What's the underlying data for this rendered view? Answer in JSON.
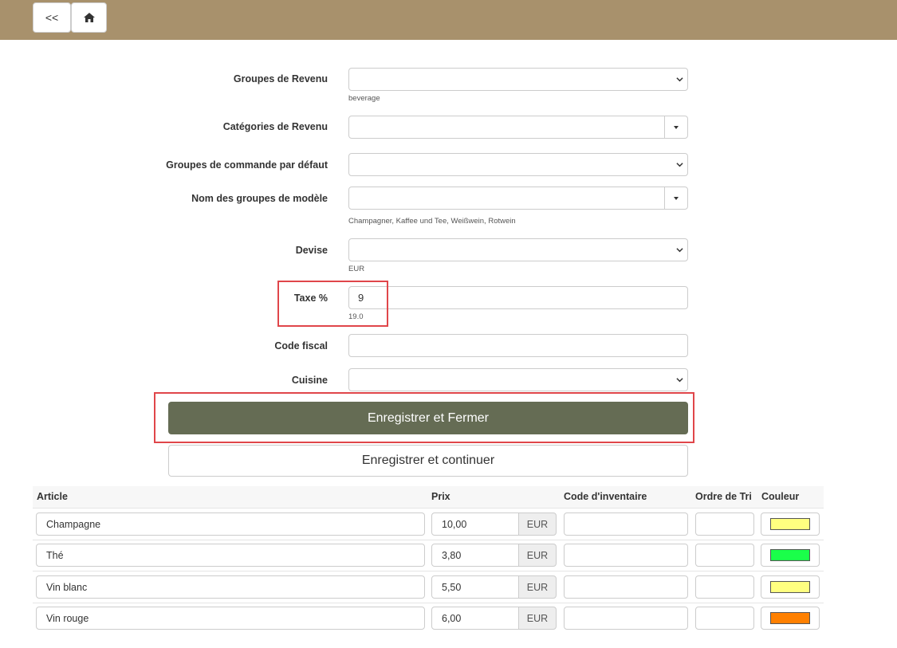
{
  "nav": {
    "back_label": "<<",
    "home_icon": "home-icon"
  },
  "form": {
    "revenue_groups": {
      "label": "Groupes de Revenu",
      "value": "",
      "hint": "beverage"
    },
    "revenue_categories": {
      "label": "Catégories de Revenu",
      "value": ""
    },
    "default_order_groups": {
      "label": "Groupes de commande par défaut",
      "value": ""
    },
    "template_group_names": {
      "label": "Nom des groupes de modèle",
      "value": "",
      "hint": "Champagner, Kaffee und Tee, Weißwein, Rotwein"
    },
    "currency": {
      "label": "Devise",
      "value": "",
      "hint": "EUR"
    },
    "tax": {
      "label": "Taxe %",
      "value": "9",
      "hint": "19.0"
    },
    "fiscal_code": {
      "label": "Code fiscal",
      "value": ""
    },
    "kitchen": {
      "label": "Cuisine",
      "value": ""
    }
  },
  "buttons": {
    "save_close": "Enregistrer et Fermer",
    "save_continue": "Enregistrer et continuer"
  },
  "table": {
    "headers": {
      "article": "Article",
      "price": "Prix",
      "inventory_code": "Code d'inventaire",
      "sort_order": "Ordre de Tri",
      "color": "Couleur"
    },
    "rows": [
      {
        "article": "Champagne",
        "price": "10,00",
        "currency": "EUR",
        "inventory_code": "",
        "sort_order": "",
        "color": "#ffff80"
      },
      {
        "article": "Thé",
        "price": "3,80",
        "currency": "EUR",
        "inventory_code": "",
        "sort_order": "",
        "color": "#1aff4a"
      },
      {
        "article": "Vin blanc",
        "price": "5,50",
        "currency": "EUR",
        "inventory_code": "",
        "sort_order": "",
        "color": "#ffff80"
      },
      {
        "article": "Vin rouge",
        "price": "6,00",
        "currency": "EUR",
        "inventory_code": "",
        "sort_order": "",
        "color": "#ff8000"
      }
    ]
  },
  "colors": {
    "topbar": "#a8916c",
    "primary_button": "#656c54",
    "highlight": "#e0464a"
  }
}
